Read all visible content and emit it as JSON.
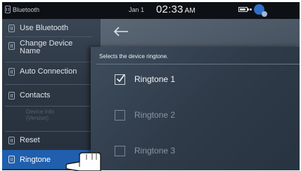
{
  "status_bar": {
    "app_label": "Bluetooth",
    "date": "Jan 1",
    "time": "02:33",
    "ampm": "AM"
  },
  "sidebar": {
    "items": [
      {
        "label": "Use Bluetooth"
      },
      {
        "label_line1": "Change Device",
        "label_line2": "Name"
      },
      {
        "label": "Auto Connection"
      },
      {
        "label": "Contacts"
      },
      {
        "label_line1": "Device Info",
        "label_line2": "(Version)"
      },
      {
        "label": "Reset"
      },
      {
        "label": "Ringtone"
      }
    ],
    "active_item": "Ringtone"
  },
  "popup": {
    "description": "Selects the device ringtone.",
    "options": [
      {
        "label": "Ringtone 1",
        "checked": true,
        "enabled": true
      },
      {
        "label": "Ringtone 2",
        "checked": false,
        "enabled": false
      },
      {
        "label": "Ringtone 3",
        "checked": false,
        "enabled": false
      }
    ]
  },
  "colors": {
    "accent": "#1f5fae",
    "sidebar_bg": "#2d3744",
    "statusbar_bg": "#0d1015"
  }
}
